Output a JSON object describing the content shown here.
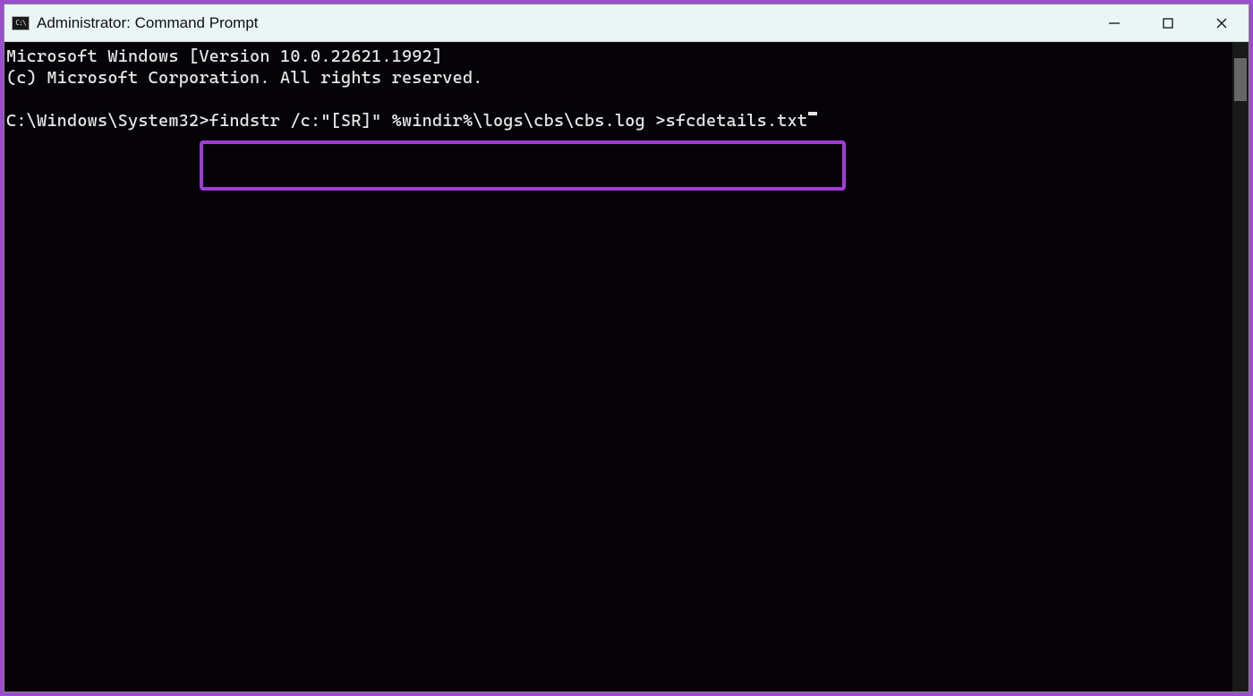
{
  "titlebar": {
    "icon_label": "C:\\",
    "title": "Administrator: Command Prompt"
  },
  "terminal": {
    "line1": "Microsoft Windows [Version 10.0.22621.1992]",
    "line2": "(c) Microsoft Corporation. All rights reserved.",
    "prompt_path": "C:\\Windows\\System32>",
    "command": "findstr /c:\"[SR]\" %windir%\\logs\\cbs\\cbs.log >sfcdetails.txt"
  },
  "colors": {
    "outer_border": "#9a4dcc",
    "highlight_border": "#a23bd6",
    "titlebar_bg": "#eaf6f6",
    "terminal_bg": "#060308"
  }
}
